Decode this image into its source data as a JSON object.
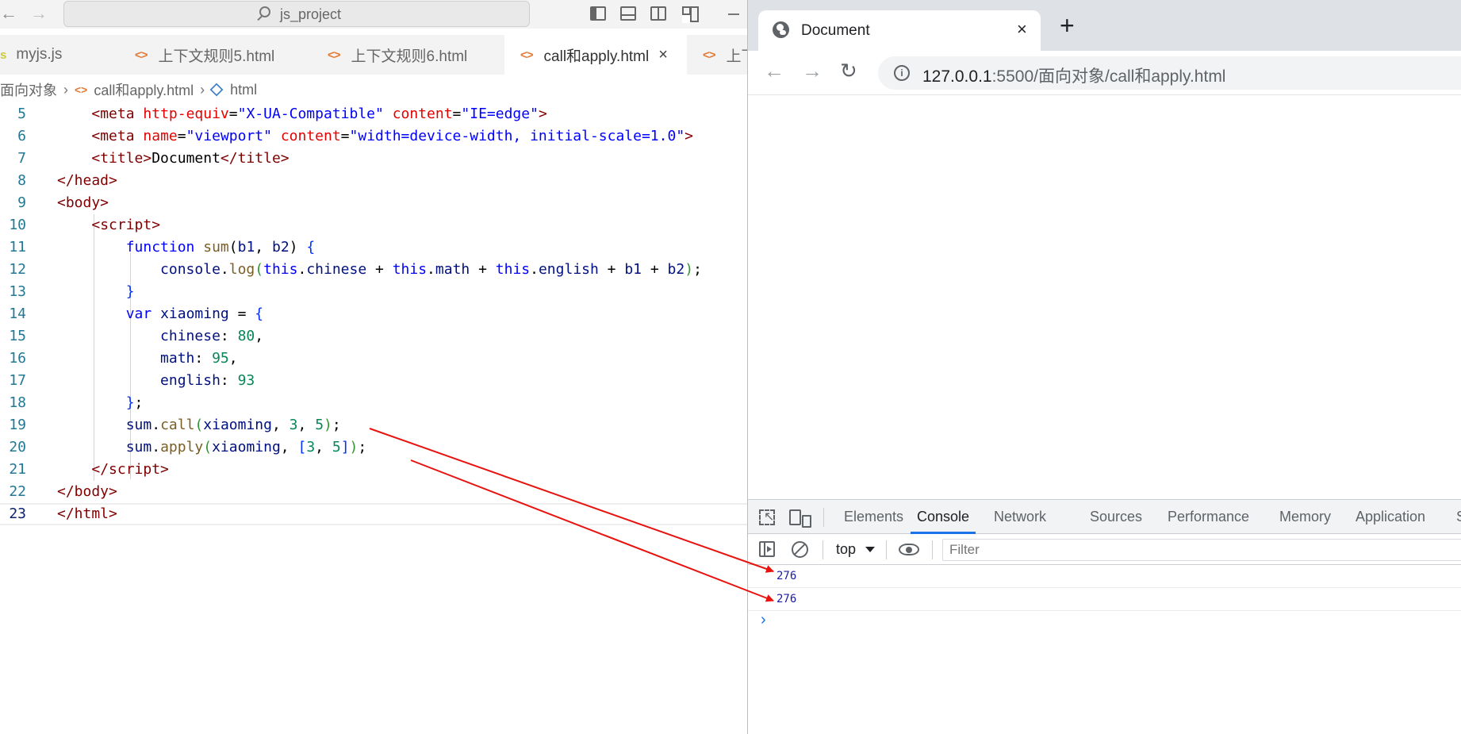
{
  "editor": {
    "search_text": "js_project",
    "tabs": [
      {
        "label": "myjs.js",
        "icon": "js-icon"
      },
      {
        "label": "上下文规则5.html",
        "icon": "html-code-icon"
      },
      {
        "label": "上下文规则6.html",
        "icon": "html-code-icon"
      },
      {
        "label": "call和apply.html",
        "icon": "html-code-icon",
        "active": true,
        "close": "×"
      },
      {
        "label": "上下",
        "icon": "html-code-icon"
      }
    ],
    "breadcrumb": {
      "folder": "面向对象",
      "file": "call和apply.html",
      "symbol": "html"
    },
    "current_line": 23
  },
  "browser": {
    "tab_title": "Document",
    "tab_close": "×",
    "new_tab": "+",
    "url_host": "127.0.0.1",
    "url_path": ":5500/面向对象/call和apply.html",
    "devtools": {
      "tabs": [
        "Elements",
        "Console",
        "Network",
        "Sources",
        "Performance",
        "Memory",
        "Application",
        "S"
      ],
      "active_tab": "Console",
      "context": "top",
      "filter_placeholder": "Filter",
      "logs": [
        "276",
        "276"
      ],
      "prompt": "›"
    }
  },
  "annotation": {
    "arrow_color": "#e8130f"
  }
}
